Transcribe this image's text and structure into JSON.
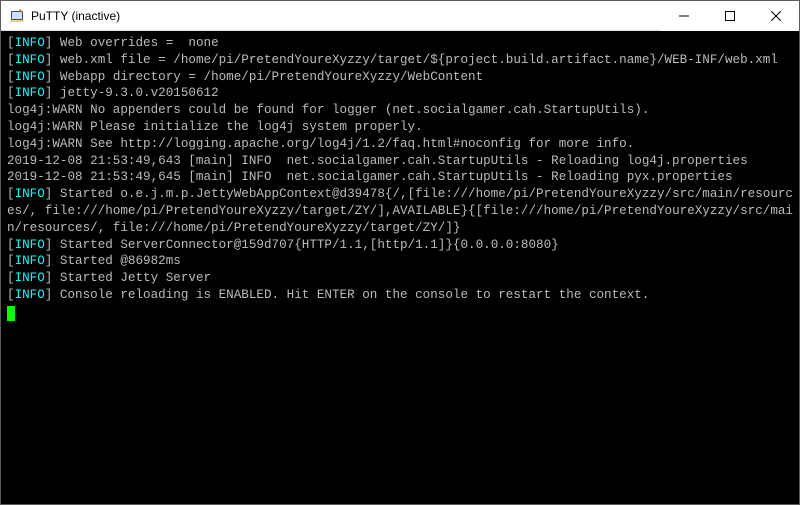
{
  "window": {
    "title": "PuTTY (inactive)",
    "icon": "putty-icon"
  },
  "titlebar": {
    "minimize": "minimize-button",
    "maximize": "maximize-button",
    "close": "close-button"
  },
  "terminal": {
    "info_label": "INFO",
    "lines": {
      "l1": " Web overrides =  none",
      "l2": " web.xml file = /home/pi/PretendYoureXyzzy/target/${project.build.artifact.name}/WEB-INF/web.xml",
      "l3": " Webapp directory = /home/pi/PretendYoureXyzzy/WebContent",
      "l4": " jetty-9.3.0.v20150612",
      "l5": "log4j:WARN No appenders could be found for logger (net.socialgamer.cah.StartupUtils).",
      "l6": "log4j:WARN Please initialize the log4j system properly.",
      "l7": "log4j:WARN See http://logging.apache.org/log4j/1.2/faq.html#noconfig for more info.",
      "l8": "2019-12-08 21:53:49,643 [main] INFO  net.socialgamer.cah.StartupUtils - Reloading log4j.properties",
      "l9": "2019-12-08 21:53:49,645 [main] INFO  net.socialgamer.cah.StartupUtils - Reloading pyx.properties",
      "l10": " Started o.e.j.m.p.JettyWebAppContext@d39478{/,[file:///home/pi/PretendYoureXyzzy/src/main/resources/, file:///home/pi/PretendYoureXyzzy/target/ZY/],AVAILABLE}{[file:///home/pi/PretendYoureXyzzy/src/main/resources/, file:///home/pi/PretendYoureXyzzy/target/ZY/]}",
      "l11": " Started ServerConnector@159d707{HTTP/1.1,[http/1.1]}{0.0.0.0:8080}",
      "l12": " Started @86982ms",
      "l13": " Started Jetty Server",
      "l14": " Console reloading is ENABLED. Hit ENTER on the console to restart the context."
    }
  }
}
